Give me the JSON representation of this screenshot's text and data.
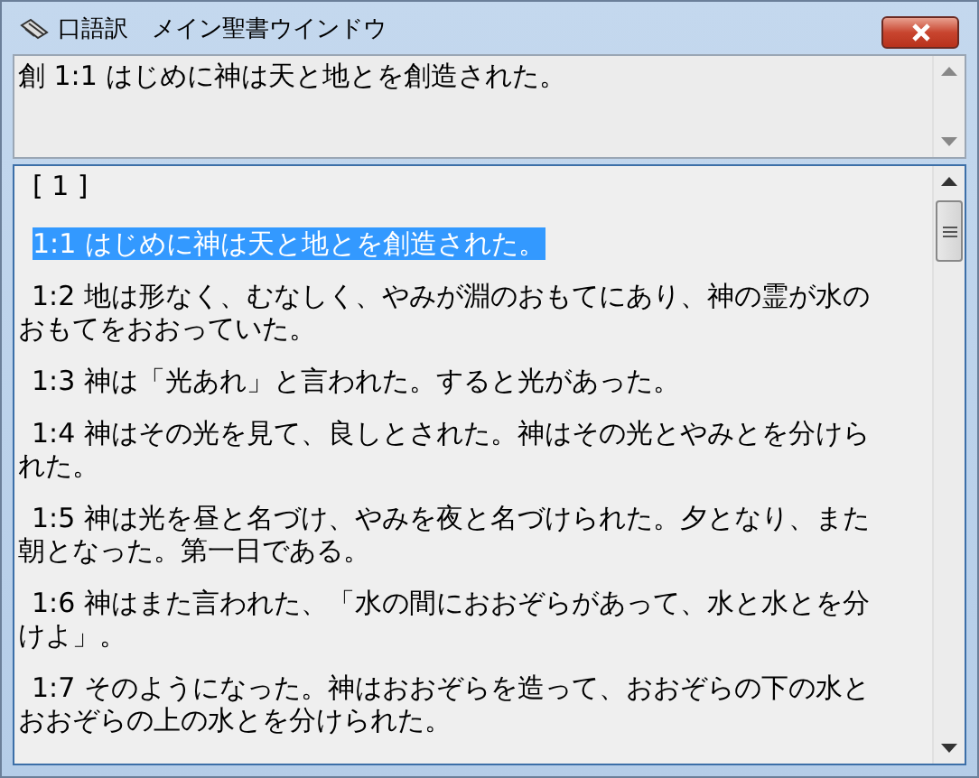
{
  "window": {
    "title": "口語訳　メイン聖書ウインドウ"
  },
  "reference_pane": {
    "text": "創 1:1 はじめに神は天と地とを創造された。"
  },
  "chapter_pane": {
    "heading": "[ 1 ]",
    "verses": [
      {
        "text": "1:1 はじめに神は天と地とを創造された。",
        "selected": true
      },
      {
        "text": "1:2 地は形なく、むなしく、やみが淵のおもてにあり、神の霊が水のおもてをおおっていた。",
        "selected": false
      },
      {
        "text": "1:3 神は「光あれ」と言われた。すると光があった。",
        "selected": false
      },
      {
        "text": "1:4 神はその光を見て、良しとされた。神はその光とやみとを分けられた。",
        "selected": false
      },
      {
        "text": "1:5 神は光を昼と名づけ、やみを夜と名づけられた。夕となり、また朝となった。第一日である。",
        "selected": false
      },
      {
        "text": "1:6 神はまた言われた、「水の間におおぞらがあって、水と水とを分けよ」。",
        "selected": false
      },
      {
        "text": "1:7 そのようになった。神はおおぞらを造って、おおぞらの下の水とおおぞらの上の水とを分けられた。",
        "selected": false
      }
    ]
  }
}
